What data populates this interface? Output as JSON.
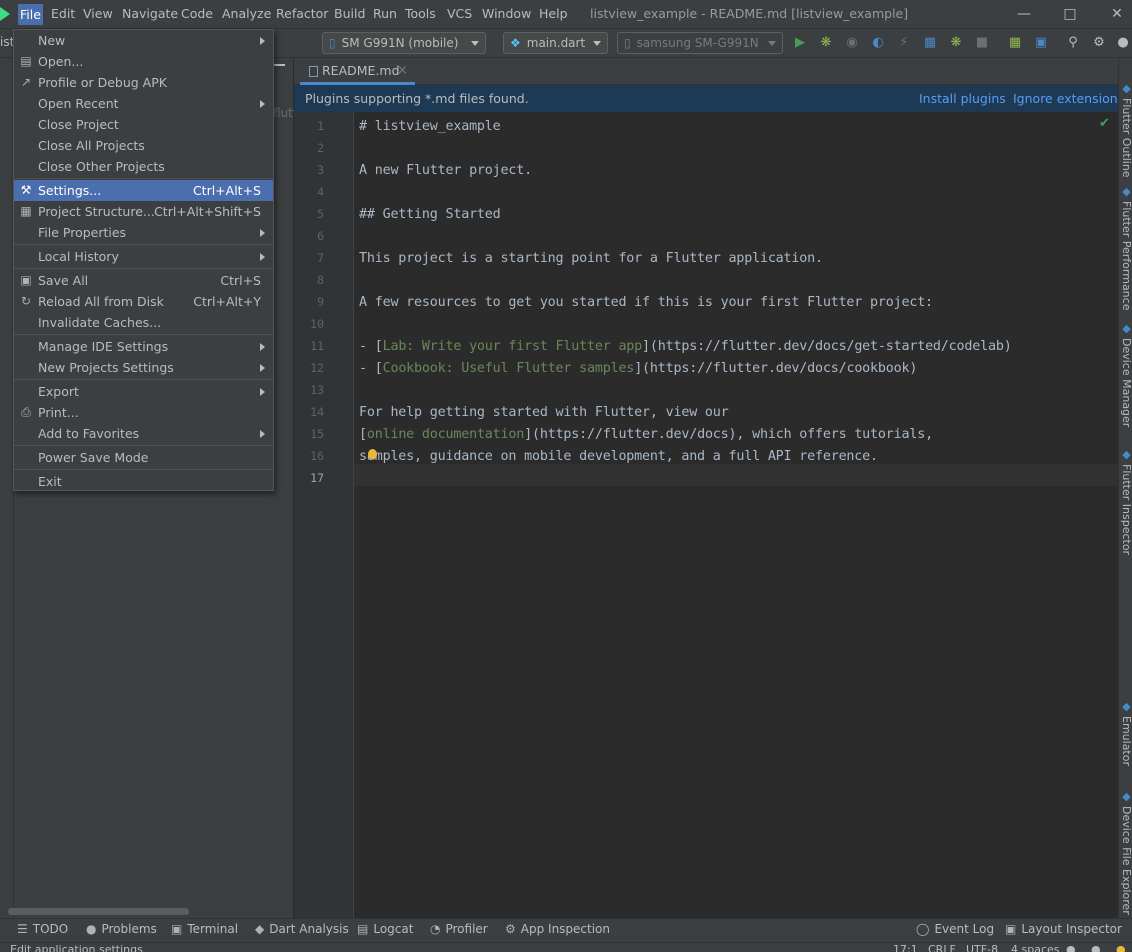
{
  "menubar": {
    "items": [
      "File",
      "Edit",
      "View",
      "Navigate",
      "Code",
      "Analyze",
      "Refactor",
      "Build",
      "Run",
      "Tools",
      "VCS",
      "Window",
      "Help"
    ],
    "window_title": "listview_example - README.md [listview_example]"
  },
  "toolbar": {
    "device_combo": "SM G991N (mobile)",
    "run_config": "main.dart",
    "device_selector": "samsung SM-G991N"
  },
  "project_panel": {
    "fragment_left": "ist",
    "fragment_tree": "flutt"
  },
  "editor": {
    "tab_label": "README.md",
    "notice": {
      "text": "Plugins supporting *.md files found.",
      "install": "Install plugins",
      "ignore": "Ignore extension"
    },
    "line_numbers": [
      "1",
      "2",
      "3",
      "4",
      "5",
      "6",
      "7",
      "8",
      "9",
      "10",
      "11",
      "12",
      "13",
      "14",
      "15",
      "16",
      "17"
    ],
    "current_line": "17",
    "lines": [
      [
        {
          "t": "# listview_example"
        }
      ],
      [],
      [
        {
          "t": "A new Flutter project."
        }
      ],
      [],
      [
        {
          "t": "## Getting Started"
        }
      ],
      [],
      [
        {
          "t": "This project is a starting point for a Flutter application."
        }
      ],
      [],
      [
        {
          "t": "A few resources to get you started if this is your first Flutter project:"
        }
      ],
      [],
      [
        {
          "t": "- ["
        },
        {
          "t": "Lab: Write your first Flutter app",
          "link": true
        },
        {
          "t": "](https://flutter.dev/docs/get-started/codelab)"
        }
      ],
      [
        {
          "t": "- ["
        },
        {
          "t": "Cookbook: Useful Flutter samples",
          "link": true
        },
        {
          "t": "](https://flutter.dev/docs/cookbook)"
        }
      ],
      [],
      [
        {
          "t": "For help getting started with Flutter, view our"
        }
      ],
      [
        {
          "t": "["
        },
        {
          "t": "online documentation",
          "link": true
        },
        {
          "t": "](https://flutter.dev/docs), which offers tutorials,"
        }
      ],
      [
        {
          "t": "samples, guidance on mobile development, and a full API reference."
        }
      ],
      []
    ]
  },
  "file_menu": {
    "items": [
      {
        "label": "New",
        "submenu": true
      },
      {
        "label": "Open...",
        "icon": "folder-icon"
      },
      {
        "label": "Profile or Debug APK",
        "icon": "apk-icon"
      },
      {
        "label": "Open Recent",
        "submenu": true
      },
      {
        "label": "Close Project"
      },
      {
        "label": "Close All Projects"
      },
      {
        "label": "Close Other Projects",
        "sep_after": true
      },
      {
        "label": "Settings...",
        "shortcut": "Ctrl+Alt+S",
        "icon": "wrench-icon",
        "selected": true
      },
      {
        "label": "Project Structure...",
        "shortcut": "Ctrl+Alt+Shift+S",
        "icon": "project-structure-icon"
      },
      {
        "label": "File Properties",
        "submenu": true,
        "sep_after": true
      },
      {
        "label": "Local History",
        "submenu": true,
        "sep_after": true
      },
      {
        "label": "Save All",
        "shortcut": "Ctrl+S",
        "icon": "save-icon"
      },
      {
        "label": "Reload All from Disk",
        "shortcut": "Ctrl+Alt+Y",
        "icon": "reload-icon"
      },
      {
        "label": "Invalidate Caches...",
        "sep_after": true
      },
      {
        "label": "Manage IDE Settings",
        "submenu": true
      },
      {
        "label": "New Projects Settings",
        "submenu": true,
        "sep_after": true
      },
      {
        "label": "Export",
        "submenu": true
      },
      {
        "label": "Print...",
        "icon": "print-icon"
      },
      {
        "label": "Add to Favorites",
        "submenu": true,
        "sep_after": true
      },
      {
        "label": "Power Save Mode",
        "sep_after": true
      },
      {
        "label": "Exit"
      }
    ]
  },
  "right_tools": [
    "Flutter Outline",
    "Flutter Performance",
    "Device Manager",
    "Flutter Inspector",
    "Emulator",
    "Device File Explorer"
  ],
  "bottom_tools": [
    {
      "label": "TODO",
      "icon": "todo-icon"
    },
    {
      "label": "Problems",
      "icon": "problems-icon"
    },
    {
      "label": "Terminal",
      "icon": "terminal-icon"
    },
    {
      "label": "Dart Analysis",
      "icon": "dart-analysis-icon"
    },
    {
      "label": "Logcat",
      "icon": "logcat-icon"
    },
    {
      "label": "Profiler",
      "icon": "profiler-icon"
    },
    {
      "label": "App Inspection",
      "icon": "app-inspection-icon"
    }
  ],
  "bottom_tools_right": [
    {
      "label": "Event Log",
      "icon": "event-log-icon"
    },
    {
      "label": "Layout Inspector",
      "icon": "layout-inspector-icon"
    }
  ],
  "statusbar": {
    "message": "Edit application settings",
    "position": "17:1",
    "line_sep": "CRLF",
    "encoding": "UTF-8",
    "indent": "4 spaces"
  },
  "colors": {
    "accent": "#4b6eaf",
    "link": "#589df6",
    "md_link": "#6a8759",
    "background": "#2b2b2b"
  }
}
